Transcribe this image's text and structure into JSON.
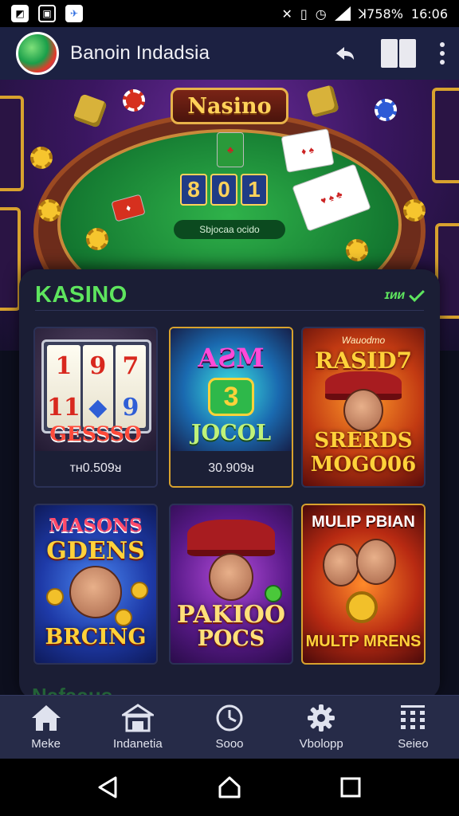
{
  "status_bar": {
    "left_icons": [
      "image-icon",
      "photo-icon",
      "plane-icon"
    ],
    "signal_text": "ꓘ758%",
    "time": "16:06"
  },
  "app_bar": {
    "title": "Banoin Indadsia",
    "logo_text": ""
  },
  "hero": {
    "sign_text": "Nasino",
    "digits": [
      "8",
      "0",
      "1"
    ],
    "table_label": "Sbjocaa ocido"
  },
  "section": {
    "title": "KASINO",
    "meta": "ɪᴎᴎ"
  },
  "games": [
    {
      "name": "slot-reels",
      "top_text": "",
      "bottom_text": "GESSSO",
      "price": "ᴛʜ0.509ᴚ"
    },
    {
      "name": "jocol",
      "top_text": "AƧM",
      "bottom_text": "JOCOL",
      "price": "30.909ᴚ"
    },
    {
      "name": "rasid",
      "small_text": "Wauodmo",
      "top_text": "RASID7",
      "bottom_text": "SRERDS",
      "bottom_text2": "MOGO06"
    },
    {
      "name": "masons-gdens",
      "top_text": "MASONS",
      "top_text2": "GDENS",
      "bottom_text": "BRCING"
    },
    {
      "name": "pakioo",
      "top_text": "",
      "bottom_text": "PAKIOO",
      "bottom_text2": "POCS"
    },
    {
      "name": "multip",
      "top_text": "MULIP PBIAN",
      "bottom_text": "MULTP MRENS"
    }
  ],
  "cut_text": "Nafaaus",
  "bottom_nav": [
    {
      "label": "Meke",
      "icon": "home-icon"
    },
    {
      "label": "Indanetia",
      "icon": "store-icon"
    },
    {
      "label": "Sooo",
      "icon": "clock-icon"
    },
    {
      "label": "Vbolopp",
      "icon": "gear-icon"
    },
    {
      "label": "Seieo",
      "icon": "grid-icon"
    }
  ],
  "colors": {
    "accent_green": "#5ee55e",
    "app_bar": "#1c2142",
    "panel": "#1b1e35",
    "gold": "#ffd23a"
  }
}
